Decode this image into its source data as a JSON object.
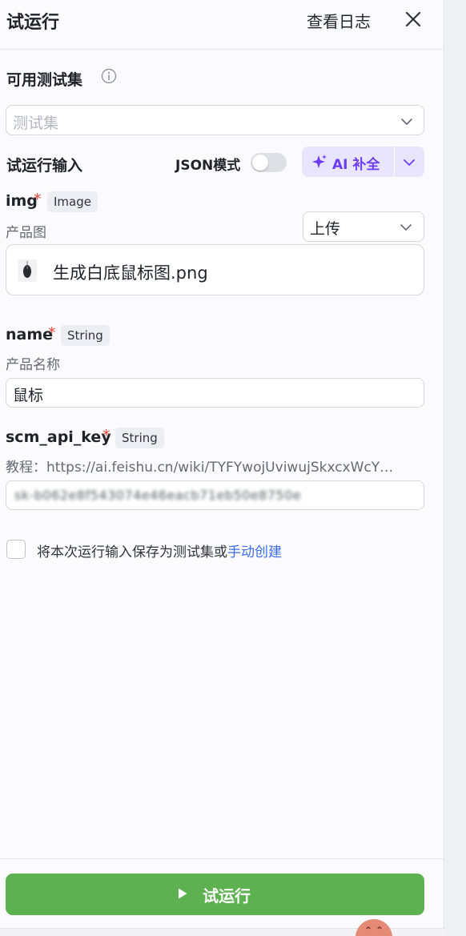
{
  "header": {
    "title": "试运行",
    "logs_label": "查看日志"
  },
  "testset": {
    "title": "可用测试集",
    "placeholder": "测试集"
  },
  "run_input": {
    "title": "试运行输入",
    "json_mode_label": "JSON模式",
    "json_mode_on": false,
    "ai_button_label": "AI 补全"
  },
  "fields": [
    {
      "name": "img",
      "required": "*",
      "type": "Image",
      "description": "产品图",
      "source_select": "上传",
      "file_name": "生成白底鼠标图.png"
    },
    {
      "name": "name",
      "required": "*",
      "type": "String",
      "description": "产品名称",
      "value": "鼠标"
    },
    {
      "name": "scm_api_key",
      "required": "*",
      "type": "String",
      "description": "教程：https://ai.feishu.cn/wiki/TYFYwojUviwujSkxcxWcY…",
      "value": "sk-b062e8f543074e46eacb71eb50e8750e"
    }
  ],
  "save": {
    "text": "将本次运行输入保存为测试集或",
    "link": "手动创建",
    "checked": false
  },
  "footer": {
    "run_label": "试运行"
  },
  "colors": {
    "accent_purple": "#6d3df5",
    "run_green": "#5db150",
    "link_blue": "#3c6cf0",
    "required_red": "#e0443a"
  }
}
